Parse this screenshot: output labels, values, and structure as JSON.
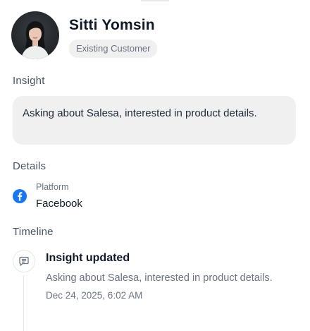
{
  "profile": {
    "name": "Sitti Yomsin",
    "badge": "Existing Customer"
  },
  "insight": {
    "title": "Insight",
    "text": "Asking about Salesa, interested in product details."
  },
  "details": {
    "title": "Details",
    "platform_label": "Platform",
    "platform_value": "Facebook",
    "platform_icon": "facebook-icon",
    "facebook_color": "#1877f2"
  },
  "timeline": {
    "title": "Timeline",
    "entries": [
      {
        "icon": "message-icon",
        "title": "Insight updated",
        "description": "Asking about Salesa, interested in product details.",
        "timestamp": "Dec 24, 2025, 6:02 AM"
      }
    ]
  }
}
